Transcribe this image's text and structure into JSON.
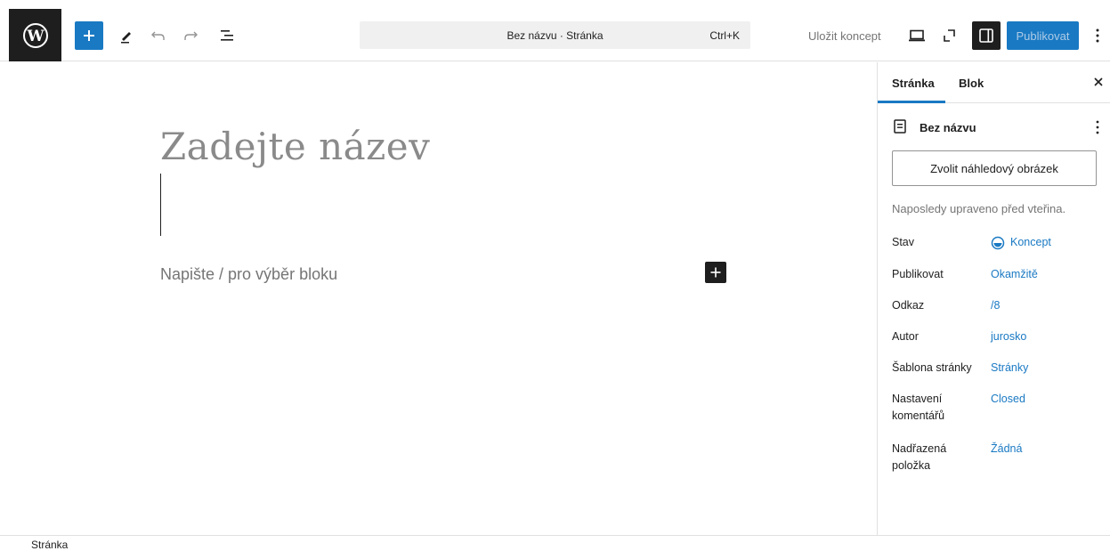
{
  "toolbar": {
    "command_title": "Bez názvu · Stránka",
    "command_shortcut": "Ctrl+K",
    "save_draft": "Uložit koncept",
    "publish": "Publikovat",
    "icons": [
      "wordpress-logo",
      "plus-icon",
      "pen-tool-icon",
      "undo-icon",
      "redo-icon",
      "document-overview-icon",
      "desktop-preview-icon",
      "external-view-icon",
      "sidebar-toggle-icon",
      "more-vertical-icon"
    ]
  },
  "editor": {
    "title_placeholder": "Zadejte název",
    "block_placeholder": "Napište / pro výběr bloku"
  },
  "sidebar": {
    "tabs": [
      {
        "label": "Stránka",
        "active": true
      },
      {
        "label": "Blok",
        "active": false
      }
    ],
    "doc_title": "Bez názvu",
    "featured_image_button": "Zvolit náhledový obrázek",
    "last_edited": "Naposledy upraveno před vteřina.",
    "rows": [
      {
        "label": "Stav",
        "value": "Koncept"
      },
      {
        "label": "Publikovat",
        "value": "Okamžitě"
      },
      {
        "label": "Odkaz",
        "value": "/8"
      },
      {
        "label": "Autor",
        "value": "jurosko"
      },
      {
        "label": "Šablona stránky",
        "value": "Stránky"
      },
      {
        "label": "Nastavení komentářů",
        "value": "Closed"
      },
      {
        "label": "Nadřazená položka",
        "value": "Žádná"
      }
    ]
  },
  "footer": {
    "breadcrumb": "Stránka"
  },
  "colors": {
    "accent": "#1979c3",
    "dark": "#1e1e1e",
    "muted": "#757575",
    "border": "#e0e0e0"
  }
}
